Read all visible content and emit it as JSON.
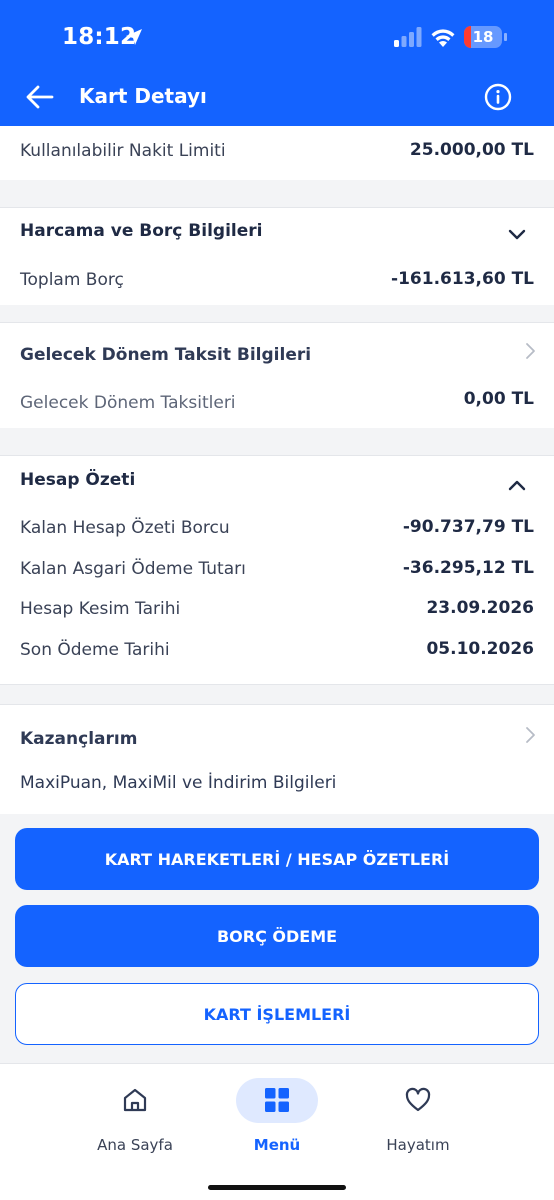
{
  "status_bar": {
    "time": "18:12",
    "battery": "18",
    "battery_fraction": 0.18
  },
  "header": {
    "title": "Kart Detayı"
  },
  "cash_limit": {
    "label": "Kullanılabilir Nakit Limiti",
    "value": "25.000,00 TL"
  },
  "spending": {
    "title": "Harcama ve Borç Bilgileri",
    "total_debt_label": "Toplam Borç",
    "total_debt_value": "-161.613,60 TL"
  },
  "installments": {
    "title": "Gelecek Dönem Taksit Bilgileri",
    "label": "Gelecek Dönem Taksitleri",
    "value": "0,00 TL"
  },
  "statement": {
    "title": "Hesap Özeti",
    "rows": [
      {
        "label": "Kalan Hesap Özeti Borcu",
        "value": "-90.737,79 TL"
      },
      {
        "label": "Kalan Asgari Ödeme Tutarı",
        "value": "-36.295,12 TL"
      },
      {
        "label": "Hesap Kesim Tarihi",
        "value": "23.09.2026"
      },
      {
        "label": "Son Ödeme Tarihi",
        "value": "05.10.2026"
      }
    ]
  },
  "earnings": {
    "title": "Kazançlarım",
    "subtitle": "MaxiPuan, MaxiMil ve İndirim Bilgileri"
  },
  "buttons": {
    "transactions": "KART HAREKETLERİ / HESAP ÖZETLERİ",
    "debt_payment": "BORÇ ÖDEME",
    "card_operations": "KART İŞLEMLERİ"
  },
  "tabbar": {
    "items": [
      {
        "label": "Ana Sayfa",
        "icon": "home-icon"
      },
      {
        "label": "Menü",
        "icon": "grid-icon",
        "active": true
      },
      {
        "label": "Hayatım",
        "icon": "heart-icon"
      }
    ]
  },
  "colors": {
    "brand": "#1463ff",
    "background": "#f3f4f6",
    "battery_low": "#ff3b30"
  }
}
